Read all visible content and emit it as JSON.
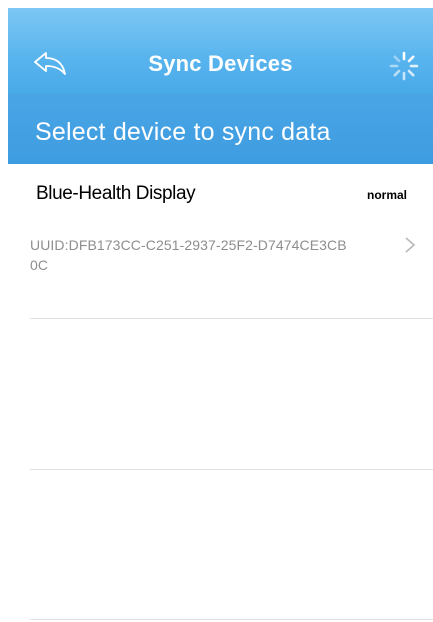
{
  "header": {
    "title": "Sync Devices",
    "back_icon": "back-arrow-icon",
    "activity_icon": "loading-spinner-icon",
    "background_color": "#5ab5ee"
  },
  "subheader": {
    "text": "Select device to sync data",
    "background_color": "#3f9de0"
  },
  "devices": [
    {
      "name": "Blue-Health Display",
      "status": "normal",
      "uuid": "UUID:DFB173CC-C251-2937-25F2-D7474CE3CB0C",
      "chevron_icon": "chevron-right-icon"
    }
  ]
}
